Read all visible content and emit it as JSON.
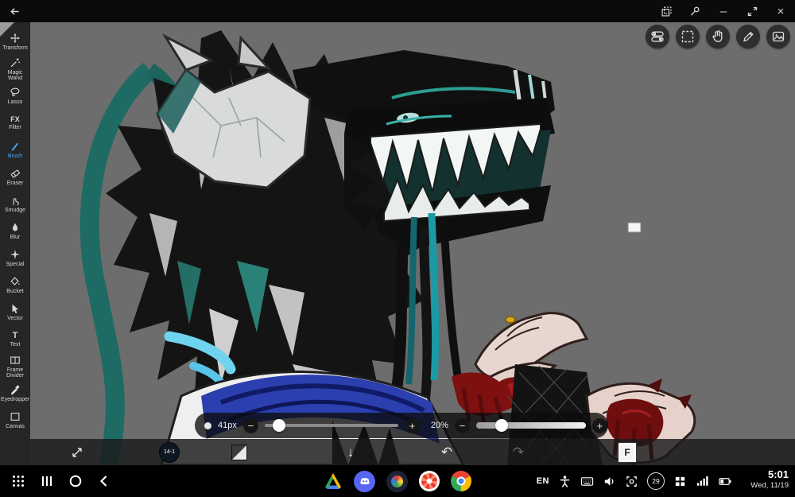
{
  "colors": {
    "accent_blue": "#4da6ff",
    "canvas_bg": "#6d6d6d",
    "teal_ribbon": "#1e6b63",
    "cyan_accent": "#6fd3f0",
    "blood_red": "#7e1010"
  },
  "glyphs": {
    "minimize": "–",
    "close": "×",
    "minus": "−",
    "plus": "+",
    "down_arrow": "↓",
    "undo": "↶",
    "redo": "↷"
  },
  "titlebar": {
    "icons": [
      "back-arrow",
      "screenshot",
      "pin",
      "minimize",
      "resize",
      "close"
    ]
  },
  "left_toolbar": {
    "active_tool": "Brush",
    "filter_icon_text": "FX",
    "text_icon_glyph": "T",
    "tools": [
      {
        "label": "Transform"
      },
      {
        "label": "Magic Wand"
      },
      {
        "label": "Lasso"
      },
      {
        "label": "Filter"
      },
      {
        "label": "Brush"
      },
      {
        "label": "Eraser"
      },
      {
        "label": "Smudge"
      },
      {
        "label": "Blur"
      },
      {
        "label": "Special"
      },
      {
        "label": "Bucket"
      },
      {
        "label": "Vector"
      },
      {
        "label": "Text"
      },
      {
        "label": "Frame Divider"
      },
      {
        "label": "Eyedropper"
      },
      {
        "label": "Canvas"
      }
    ]
  },
  "top_tools": {
    "buttons": [
      "panel-toggle",
      "select",
      "hand",
      "pen",
      "materials"
    ]
  },
  "sliders": {
    "brush_size": {
      "label": "41px"
    },
    "opacity": {
      "label": "20%"
    }
  },
  "bottom_bar": {
    "brush_preview_label": "14-1",
    "layer_badge": "F",
    "icons": [
      "transform-view",
      "brush-preview",
      "gradient-swatch",
      "hide-ui",
      "undo",
      "redo",
      "layer-panel"
    ]
  },
  "navbar": {
    "language": "EN",
    "battery_percent": "29",
    "time": "5:01",
    "date": "Wed, 11/19",
    "left_icons": [
      "apps-grid",
      "recents",
      "home",
      "back"
    ],
    "app_icons": [
      "drive",
      "discord",
      "paint-app",
      "gallery-app",
      "chrome"
    ],
    "status_icons": [
      "accessibility",
      "keyboard",
      "volume",
      "capture",
      "battery-circle",
      "grid-small",
      "signal",
      "battery"
    ]
  }
}
